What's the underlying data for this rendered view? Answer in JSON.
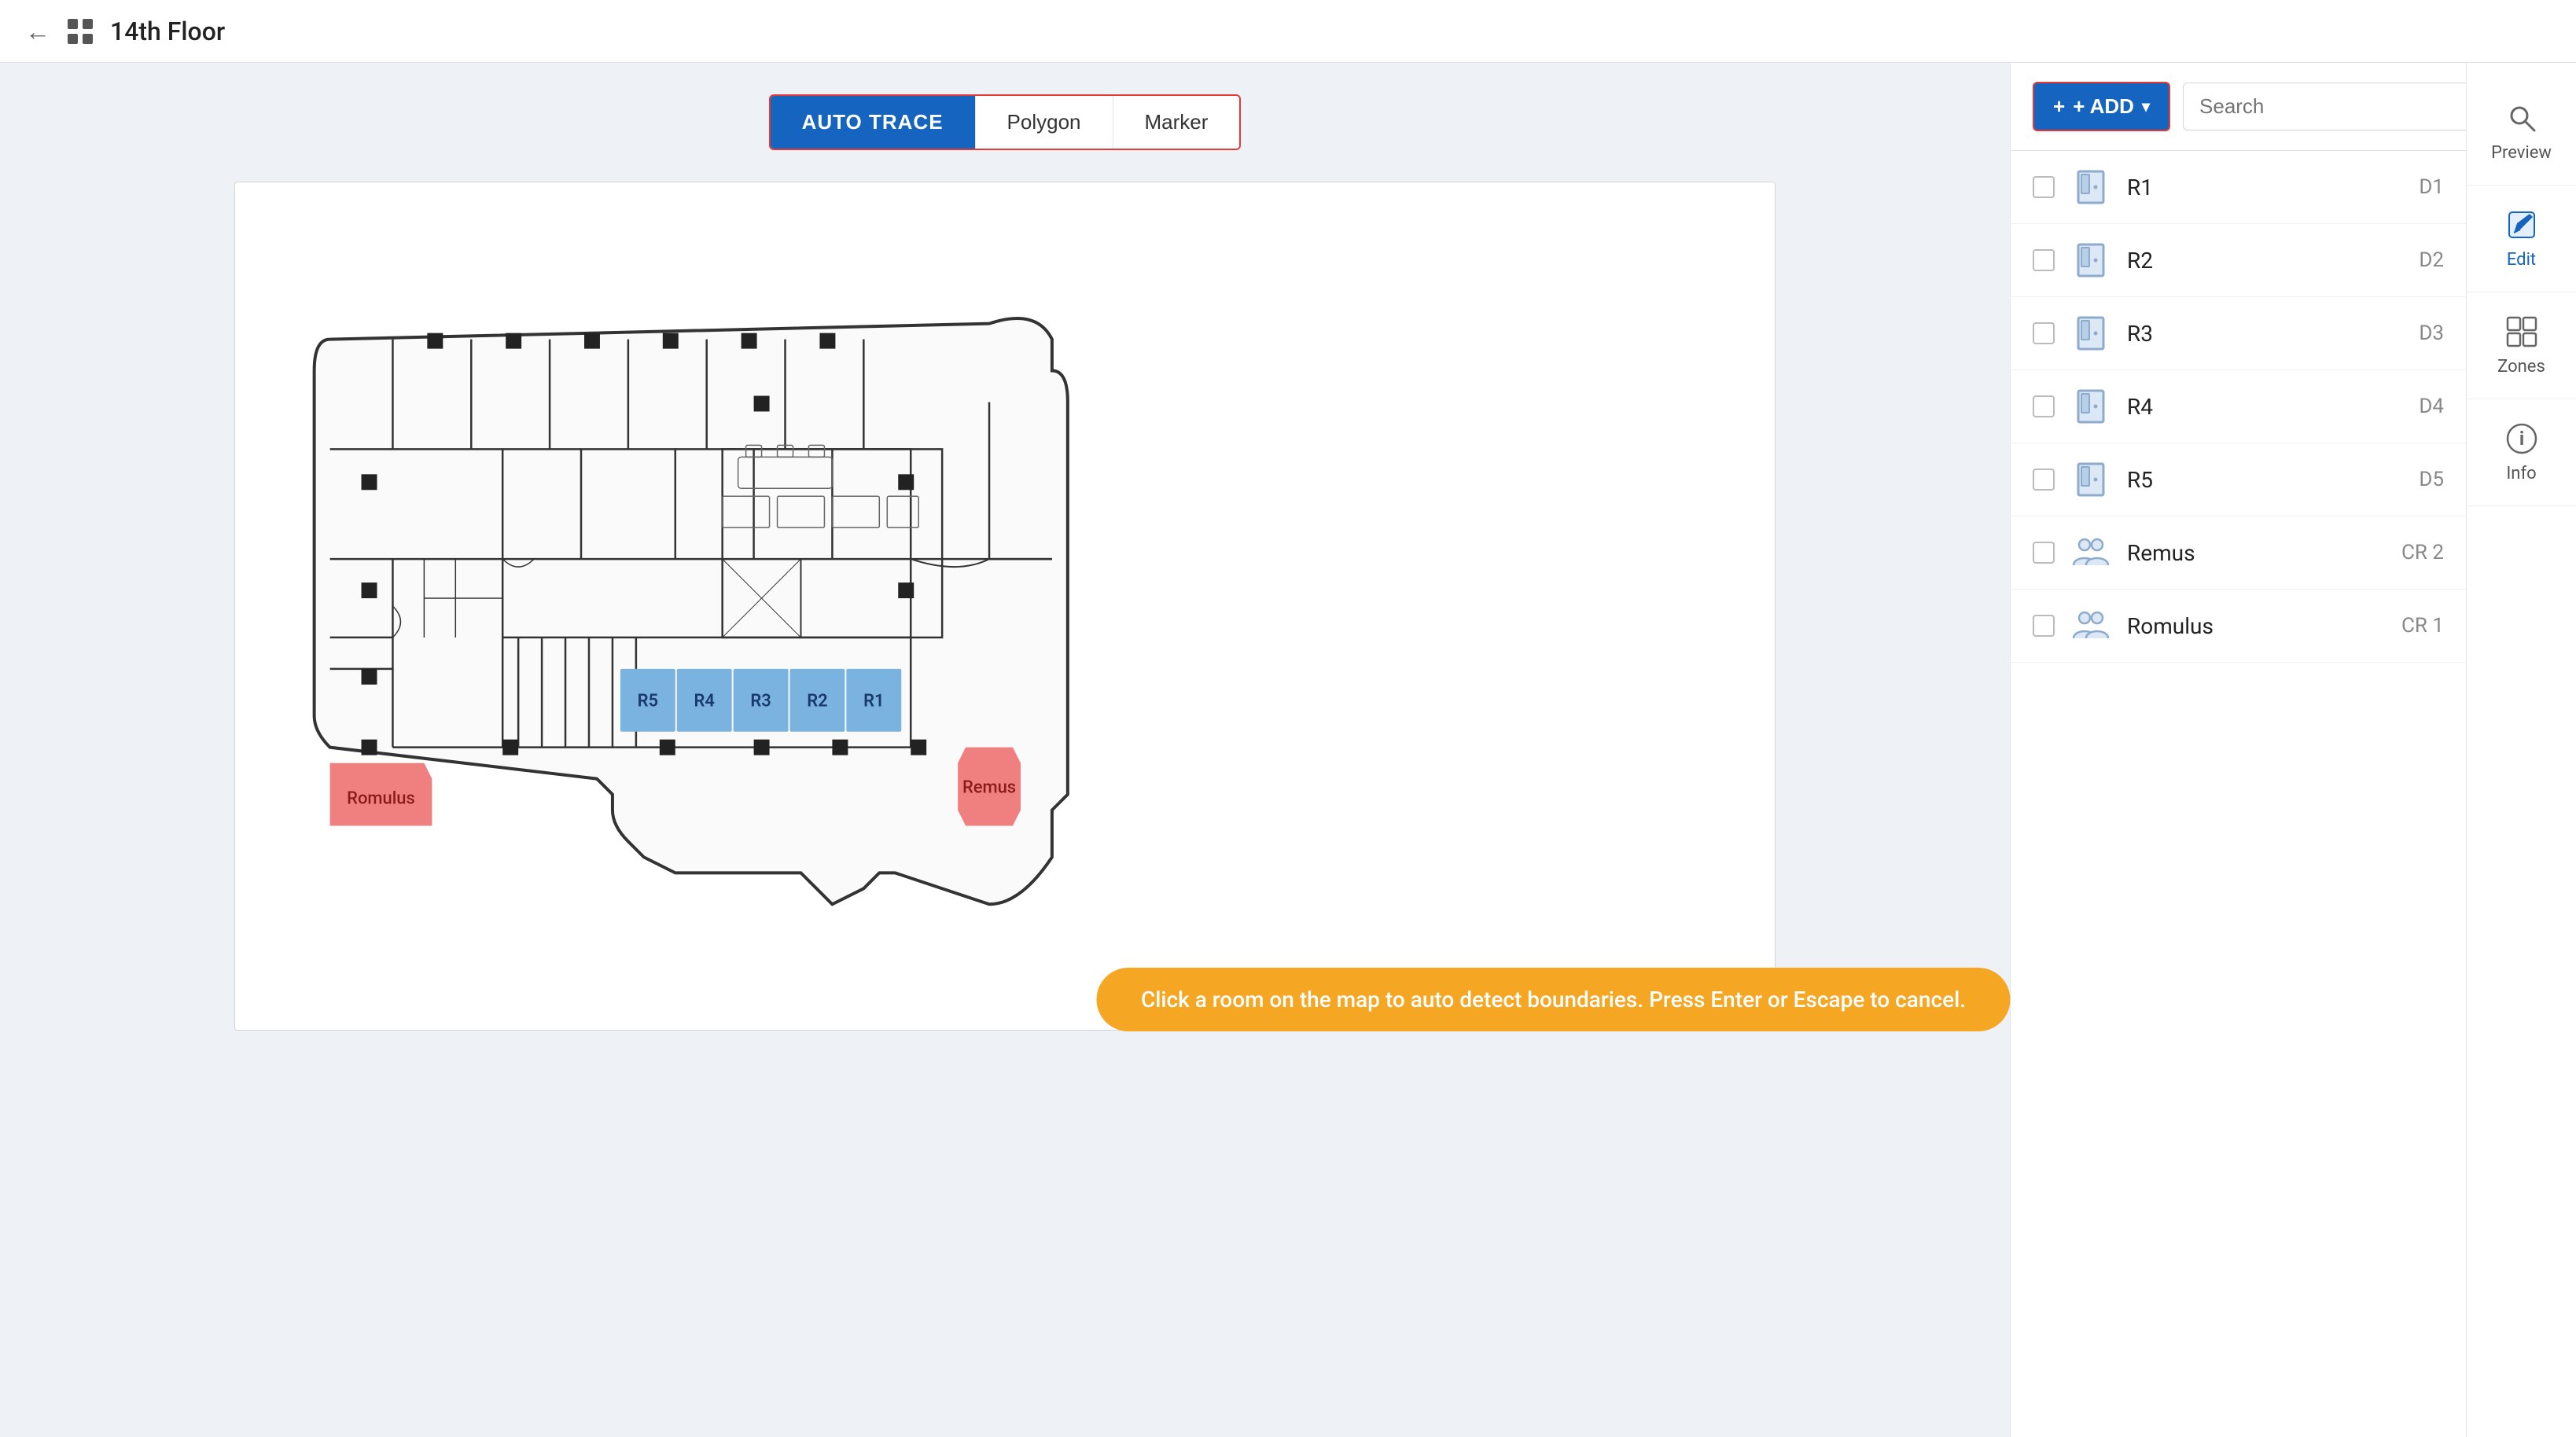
{
  "topbar": {
    "back_label": "←",
    "grid_icon": "grid",
    "title": "14th Floor"
  },
  "toolbar": {
    "auto_trace_label": "AUTO TRACE",
    "polygon_label": "Polygon",
    "marker_label": "Marker"
  },
  "hint": {
    "text": "Click a room on the map to auto detect boundaries. Press Enter or Escape to cancel."
  },
  "right_panel": {
    "add_button_label": "+ ADD",
    "search_placeholder": "Search",
    "rooms": [
      {
        "id": "r1",
        "name": "R1",
        "code": "D1",
        "type": "door"
      },
      {
        "id": "r2",
        "name": "R2",
        "code": "D2",
        "type": "door"
      },
      {
        "id": "r3",
        "name": "R3",
        "code": "D3",
        "type": "door"
      },
      {
        "id": "r4",
        "name": "R4",
        "code": "D4",
        "type": "door"
      },
      {
        "id": "r5",
        "name": "R5",
        "code": "D5",
        "type": "door"
      },
      {
        "id": "remus",
        "name": "Remus",
        "code": "CR 2",
        "type": "people"
      },
      {
        "id": "romulus",
        "name": "Romulus",
        "code": "CR 1",
        "type": "people"
      }
    ]
  },
  "far_sidebar": {
    "items": [
      {
        "id": "preview",
        "label": "Preview",
        "icon": "search"
      },
      {
        "id": "edit",
        "label": "Edit",
        "icon": "edit",
        "active": true
      },
      {
        "id": "zones",
        "label": "Zones",
        "icon": "zones"
      },
      {
        "id": "info",
        "label": "Info",
        "icon": "info"
      }
    ]
  },
  "colors": {
    "blue_room": "#7bb3e0",
    "red_room": "#f08080",
    "accent_blue": "#1565c0",
    "accent_red": "#e53935"
  }
}
